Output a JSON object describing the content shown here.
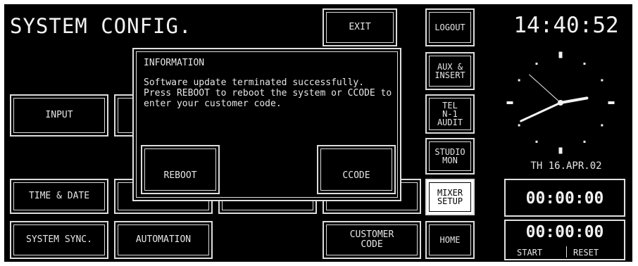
{
  "title": "SYSTEM CONFIG.",
  "buttons": {
    "exit": "EXIT",
    "input": "INPUT",
    "time_date": "TIME & DATE",
    "system_sync": "SYSTEM SYNC.",
    "automation": "AUTOMATION",
    "customer_code": "CUSTOMER\nCODE"
  },
  "side_buttons": {
    "logout": "LOGOUT",
    "aux_insert": "AUX &\nINSERT",
    "tel_n1_audit": "TEL\nN-1\nAUDIT",
    "studio_mon": "STUDIO\nMON",
    "mixer_setup": "MIXER\nSETUP",
    "home": "HOME"
  },
  "clock": {
    "time": "14:40:52",
    "date": "TH 16.APR.02",
    "hour": 14,
    "minute": 40,
    "second": 52
  },
  "timer1": "00:00:00",
  "timer2": {
    "value": "00:00:00",
    "start": "START",
    "reset": "RESET"
  },
  "dialog": {
    "title": "INFORMATION",
    "message": "Software update terminated successfully. Press REBOOT to reboot the system or CCODE to enter your customer code.",
    "reboot": "REBOOT",
    "ccode": "CCODE"
  },
  "colors": {
    "background": "#000000",
    "foreground": "#e6e6e6",
    "highlight": "#ffffff"
  }
}
